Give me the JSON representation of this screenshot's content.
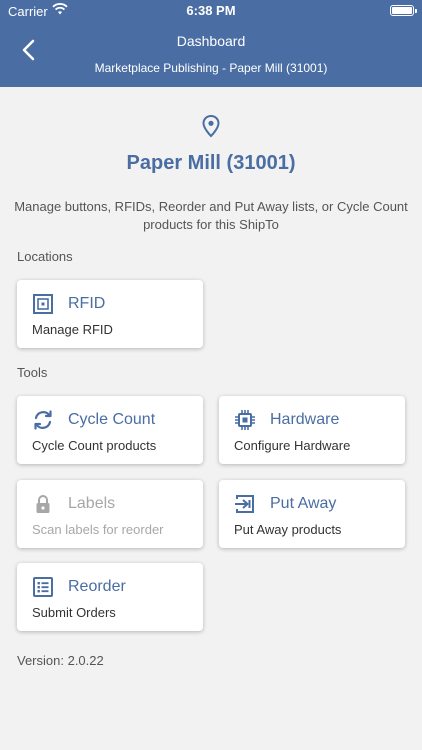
{
  "status_bar": {
    "carrier": "Carrier",
    "time": "6:38 PM"
  },
  "nav": {
    "title": "Dashboard",
    "subtitle": "Marketplace Publishing - Paper Mill (31001)"
  },
  "page": {
    "title": "Paper Mill (31001)",
    "description": "Manage buttons, RFIDs, Reorder and Put Away lists, or Cycle Count products for this ShipTo"
  },
  "sections": {
    "locations": "Locations",
    "tools": "Tools"
  },
  "cards": {
    "rfid": {
      "title": "RFID",
      "subtitle": "Manage RFID",
      "icon": "rfid-icon"
    },
    "cycle_count": {
      "title": "Cycle Count",
      "subtitle": "Cycle Count products",
      "icon": "refresh-icon"
    },
    "hardware": {
      "title": "Hardware",
      "subtitle": "Configure Hardware",
      "icon": "chip-icon"
    },
    "labels": {
      "title": "Labels",
      "subtitle": "Scan labels for reorder",
      "icon": "lock-icon",
      "disabled": true
    },
    "put_away": {
      "title": "Put Away",
      "subtitle": "Put Away products",
      "icon": "put-away-icon"
    },
    "reorder": {
      "title": "Reorder",
      "subtitle": "Submit Orders",
      "icon": "list-icon"
    }
  },
  "version": "Version: 2.0.22",
  "colors": {
    "header": "#4a6ea3",
    "accent": "#4a6ea3",
    "background": "#f2f2f2",
    "disabled": "#a7a7a7"
  }
}
